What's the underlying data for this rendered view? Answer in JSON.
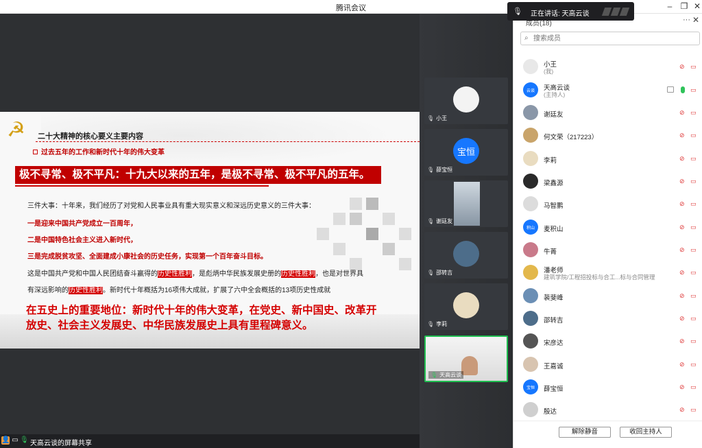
{
  "window": {
    "title": "腾讯会议",
    "speaking_prefix": "正在讲话: 天高云谈"
  },
  "slide": {
    "heading": "二十大精神的核心要义主要内容",
    "subheading": "过去五年的工作和新时代十年的伟大变革",
    "banner": "极不寻常、极不平凡：十九大以来的五年，是极不寻常、极不平凡的五年。",
    "intro": "三件大事：十年来，我们经历了对党和人民事业具有重大现实意义和深远历史意义的三件大事：",
    "item1": "一是迎来中国共产党成立一百周年，",
    "item2": "二是中国特色社会主义进入新时代，",
    "item3": "三是完成脱贫攻坚、全面建成小康社会的历史任务，实现第一个百年奋斗目标。",
    "line4_a": "这是中国共产党和中国人民团结奋斗赢得的",
    "line4_hl1": "历史性胜利",
    "line4_b": "，是彪炳中华民族发展史册的",
    "line4_hl2": "历史性胜利",
    "line4_c": "，也是对世界具",
    "line5_a": "有深远影响的",
    "line5_hl": "历史性胜利",
    "line5_b": "。新时代十年概括为16项伟大成就，扩展了六中全会概括的13项历史性成就",
    "big1": "在五史上的重要地位：新时代十年的伟大变革，在党史、新中国史、改革开",
    "big2": "放史、社会主义发展史、中华民族发展史上具有里程碑意义。"
  },
  "share_bar": {
    "label": "天高云谈的屏幕共享"
  },
  "video_tiles": [
    {
      "name": "小王",
      "avatar_text": ""
    },
    {
      "name": "薛宝恒",
      "avatar_text": "宝恒"
    },
    {
      "name": "谢廷友",
      "avatar_text": ""
    },
    {
      "name": "邵转吉",
      "avatar_text": ""
    },
    {
      "name": "李莉",
      "avatar_text": ""
    },
    {
      "name": "天高云谈",
      "avatar_text": ""
    }
  ],
  "panel": {
    "title": "成员(18)",
    "more": "···",
    "search_placeholder": "搜索成员",
    "members": [
      {
        "name": "小王",
        "sub": "(我)",
        "avatar_text": "",
        "color": "#e8e8e8"
      },
      {
        "name": "天高云谈",
        "sub": "(主持人)",
        "avatar_text": "云谈",
        "color": "#1677ff"
      },
      {
        "name": "谢廷友",
        "sub": "",
        "avatar_text": "",
        "color": "#8a97a8"
      },
      {
        "name": "何文荣（217223）",
        "sub": "",
        "avatar_text": "",
        "color": "#c9a46a"
      },
      {
        "name": "李莉",
        "sub": "",
        "avatar_text": "",
        "color": "#e9dcc0"
      },
      {
        "name": "梁鑫源",
        "sub": "",
        "avatar_text": "",
        "color": "#2a2a2a"
      },
      {
        "name": "马智鹏",
        "sub": "",
        "avatar_text": "",
        "color": "#dcdcdc"
      },
      {
        "name": "麦积山",
        "sub": "",
        "avatar_text": "积山",
        "color": "#1677ff"
      },
      {
        "name": "牛菁",
        "sub": "",
        "avatar_text": "",
        "color": "#c97a8a"
      },
      {
        "name": "潘老师",
        "sub": "建筑学院/工程招投标与合工...标与合同管理",
        "avatar_text": "",
        "color": "#e3b84c"
      },
      {
        "name": "裴斐峰",
        "sub": "",
        "avatar_text": "",
        "color": "#6b8fb5"
      },
      {
        "name": "邵转吉",
        "sub": "",
        "avatar_text": "",
        "color": "#4d6d8a"
      },
      {
        "name": "宋彦达",
        "sub": "",
        "avatar_text": "",
        "color": "#555555"
      },
      {
        "name": "王嘉诚",
        "sub": "",
        "avatar_text": "",
        "color": "#d8c4b0"
      },
      {
        "name": "薛宝恒",
        "sub": "",
        "avatar_text": "宝恒",
        "color": "#1677ff"
      },
      {
        "name": "殷达",
        "sub": "",
        "avatar_text": "",
        "color": "#cfcfcf"
      }
    ],
    "mute_all": "解除静音",
    "reclaim_host": "收回主持人"
  }
}
